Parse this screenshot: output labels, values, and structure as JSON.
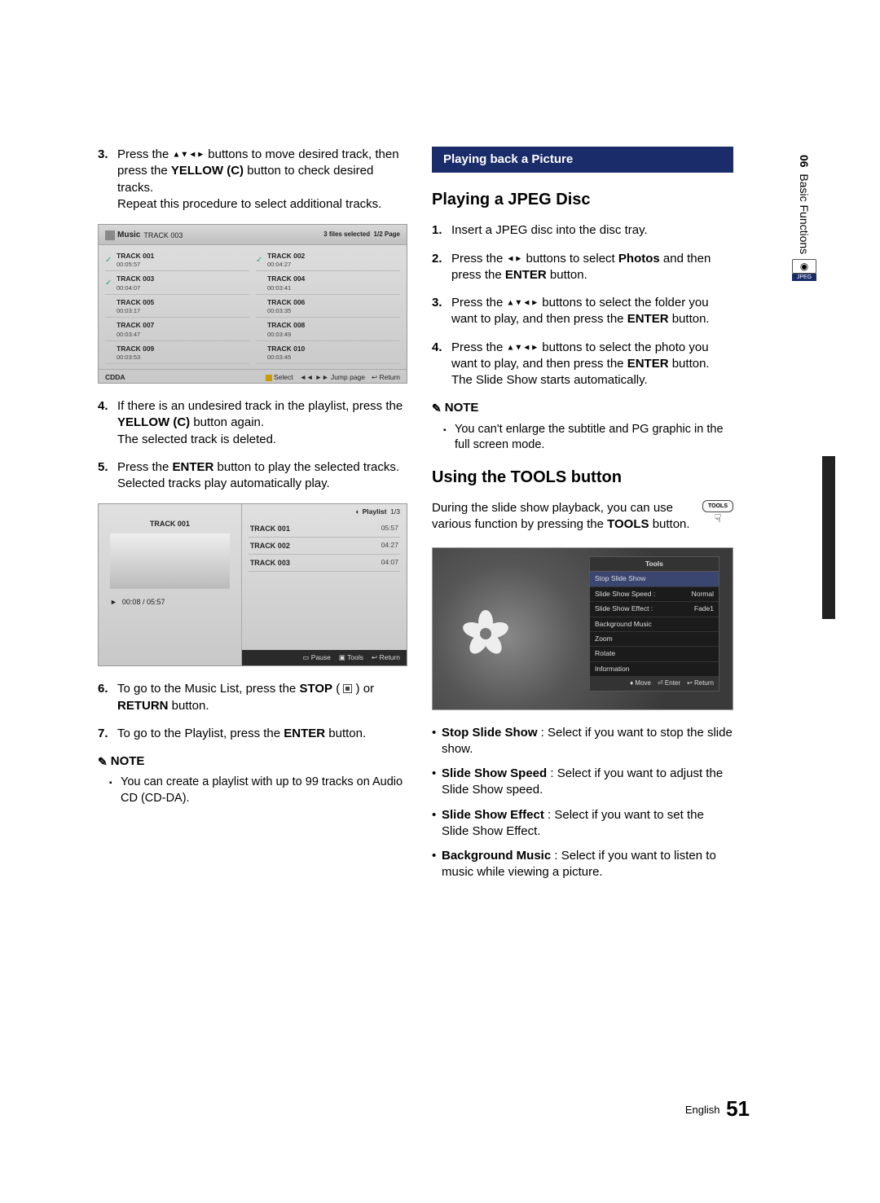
{
  "sidebar": {
    "chapter_num": "06",
    "chapter_title": "Basic Functions",
    "jpeg_label": "JPEG"
  },
  "footer": {
    "lang": "English",
    "page": "51"
  },
  "left": {
    "steps_a": [
      {
        "n": "3.",
        "pre": "Press the ",
        "dir": "▲▼◄►",
        "post": " buttons to move desired track, then press the ",
        "btn": "YELLOW (C)",
        "post2": " button to check desired tracks.",
        "extra": "Repeat this procedure to select additional tracks."
      }
    ],
    "music_screen": {
      "title": "Music",
      "crumb": "TRACK 003",
      "status": "3 files selected",
      "page": "1/2 Page",
      "tracks": [
        {
          "name": "TRACK 001",
          "dur": "00:05:57",
          "ck": true
        },
        {
          "name": "TRACK 002",
          "dur": "00:04:27",
          "ck": true
        },
        {
          "name": "TRACK 003",
          "dur": "00:04:07",
          "ck": true
        },
        {
          "name": "TRACK 004",
          "dur": "00:03:41",
          "ck": false
        },
        {
          "name": "TRACK 005",
          "dur": "00:03:17",
          "ck": false
        },
        {
          "name": "TRACK 006",
          "dur": "00:03:35",
          "ck": false
        },
        {
          "name": "TRACK 007",
          "dur": "00:03:47",
          "ck": false
        },
        {
          "name": "TRACK 008",
          "dur": "00:03:49",
          "ck": false
        },
        {
          "name": "TRACK 009",
          "dur": "00:03:53",
          "ck": false
        },
        {
          "name": "TRACK 010",
          "dur": "00:03:45",
          "ck": false
        }
      ],
      "source": "CDDA",
      "select": "Select",
      "jump": "Jump page",
      "ret": "Return"
    },
    "steps_b": [
      {
        "n": "4.",
        "t1": "If there is an undesired track in the playlist, press the ",
        "btn": "YELLOW (C)",
        "t2": " button again.",
        "t3": "The selected track is deleted."
      },
      {
        "n": "5.",
        "t1": "Press the ",
        "btn": "ENTER",
        "t2": " button to play the selected tracks.",
        "t3": "Selected tracks play automatically play."
      }
    ],
    "play_screen": {
      "now": "TRACK 001",
      "time": "00:08 / 05:57",
      "pl_label": "Playlist",
      "pl_page": "1/3",
      "items": [
        {
          "n": "TRACK 001",
          "d": "05:57"
        },
        {
          "n": "TRACK 002",
          "d": "04:27"
        },
        {
          "n": "TRACK 003",
          "d": "04:07"
        }
      ],
      "pause": "Pause",
      "tools": "Tools",
      "ret": "Return"
    },
    "steps_c": [
      {
        "n": "6.",
        "t1": "To go to the Music List, press the ",
        "btn": "STOP",
        "t2": " or ",
        "btn2": "RETURN",
        "t3": " button."
      },
      {
        "n": "7.",
        "t1": "To go to the Playlist, press the ",
        "btn": "ENTER",
        "t2": " button."
      }
    ],
    "note_hdr": "NOTE",
    "note_body": "You can create a playlist with up to 99 tracks on Audio CD (CD-DA)."
  },
  "right": {
    "section": "Playing back a Picture",
    "h2a": "Playing a JPEG Disc",
    "jpeg_steps": [
      {
        "n": "1.",
        "t": "Insert a JPEG disc into the disc tray."
      },
      {
        "n": "2.",
        "t1": "Press the ",
        "dir": "◄►",
        "t2": " buttons to select ",
        "b": "Photos",
        "t3": " and then press the ",
        "b2": "ENTER",
        "t4": " button."
      },
      {
        "n": "3.",
        "t1": "Press the ",
        "dir": "▲▼◄►",
        "t2": " buttons to select the folder you want to play, and then press the ",
        "b": "ENTER",
        "t3": " button."
      },
      {
        "n": "4.",
        "t1": "Press the ",
        "dir": "▲▼◄►",
        "t2": " buttons to select the photo you want to play, and then press the ",
        "b": "ENTER",
        "t3": " button.",
        "extra": "The Slide Show starts automatically."
      }
    ],
    "note_hdr": "NOTE",
    "note_body": "You can't enlarge the subtitle and PG graphic in the full screen mode.",
    "h2b": "Using the TOOLS button",
    "tools_para1": "During the slide show playback, you can use various function by pressing the ",
    "tools_btn": "TOOLS",
    "tools_para2": " button.",
    "tools_key": "TOOLS",
    "tools_menu": {
      "title": "Tools",
      "items": [
        {
          "l": "Stop Slide Show",
          "v": "",
          "sel": true
        },
        {
          "l": "Slide Show Speed :",
          "v": "Normal"
        },
        {
          "l": "Slide Show Effect  :",
          "v": "Fade1"
        },
        {
          "l": "Background Music",
          "v": ""
        },
        {
          "l": "Zoom",
          "v": ""
        },
        {
          "l": "Rotate",
          "v": ""
        },
        {
          "l": "Information",
          "v": ""
        }
      ],
      "move": "Move",
      "enter": "Enter",
      "ret": "Return"
    },
    "bullets": [
      {
        "b": "Stop Slide Show",
        "t": " : Select if you want to stop the slide show."
      },
      {
        "b": "Slide Show Speed",
        "t": " : Select if you want to adjust the Slide Show speed."
      },
      {
        "b": "Slide Show Effect",
        "t": " : Select if you want to set the Slide Show Effect."
      },
      {
        "b": "Background Music",
        "t": " : Select if you want to listen to music while viewing a picture."
      }
    ]
  }
}
